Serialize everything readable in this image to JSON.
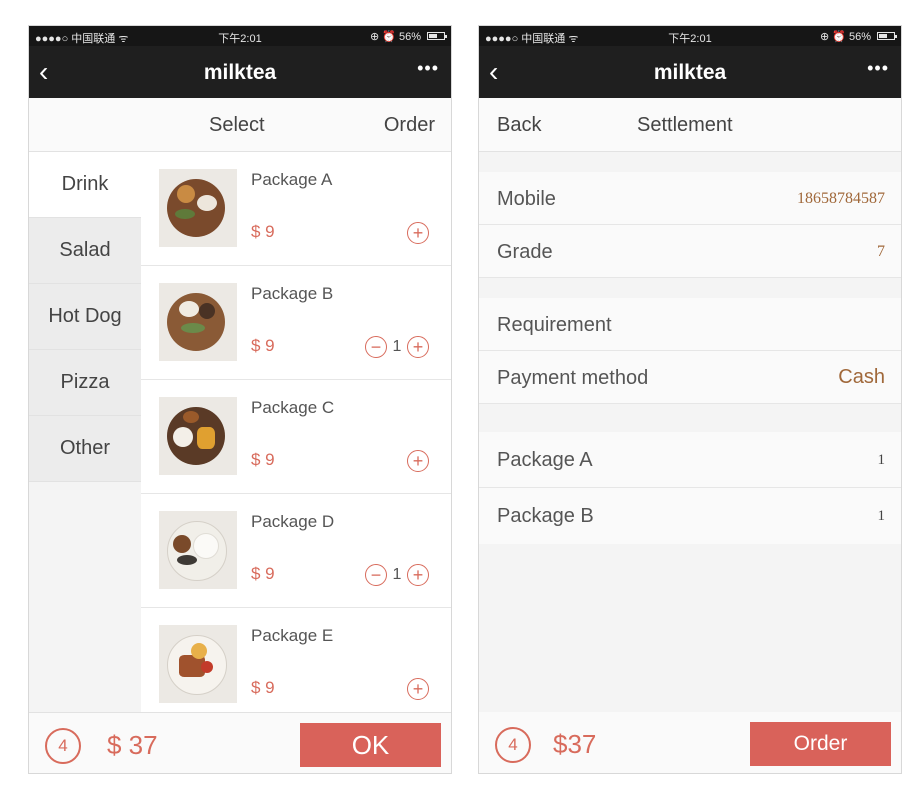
{
  "status_bar": {
    "carrier": "●●●●○ 中国联通 ᯤ",
    "time": "下午2:01",
    "battery": "⊕ ⏰ 56%"
  },
  "left_screen": {
    "nav": {
      "back_icon": "‹",
      "title": "milktea",
      "more_icon": "•••"
    },
    "tabs": {
      "select": "Select",
      "order": "Order"
    },
    "categories": [
      "Drink",
      "Salad",
      "Hot Dog",
      "Pizza",
      "Other"
    ],
    "products": [
      {
        "name": "Package A",
        "price": "$ 9",
        "quantity": ""
      },
      {
        "name": "Package B",
        "price": "$ 9",
        "quantity": "1"
      },
      {
        "name": "Package C",
        "price": "$ 9",
        "quantity": ""
      },
      {
        "name": "Package D",
        "price": "$ 9",
        "quantity": "1"
      },
      {
        "name": "Package E",
        "price": "$ 9",
        "quantity": ""
      }
    ],
    "controls": {
      "minus": "−",
      "plus": "+"
    },
    "bottom": {
      "cart_count": "4",
      "total": "$ 37",
      "ok_label": "OK"
    }
  },
  "right_screen": {
    "nav": {
      "back_icon": "‹",
      "title": "milktea",
      "more_icon": "•••"
    },
    "header": {
      "back": "Back",
      "title": "Settlement"
    },
    "info": {
      "mobile_label": "Mobile",
      "mobile_value": "18658784587",
      "grade_label": "Grade",
      "grade_value": "7"
    },
    "requirement_label": "Requirement",
    "payment": {
      "label": "Payment method",
      "value": "Cash"
    },
    "items": [
      {
        "name": "Package A",
        "qty": "1"
      },
      {
        "name": "Package B",
        "qty": "1"
      }
    ],
    "bottom": {
      "cart_count": "4",
      "total": "$37",
      "order_label": "Order"
    }
  },
  "colors": {
    "accent": "#d9625a",
    "price": "#d86b5c",
    "value_brown": "#a0683a",
    "nav_bg": "#1f1f1f"
  },
  "icons": [
    "back-icon",
    "more-icon",
    "plus-icon",
    "minus-icon",
    "battery-icon",
    "wifi-icon"
  ]
}
